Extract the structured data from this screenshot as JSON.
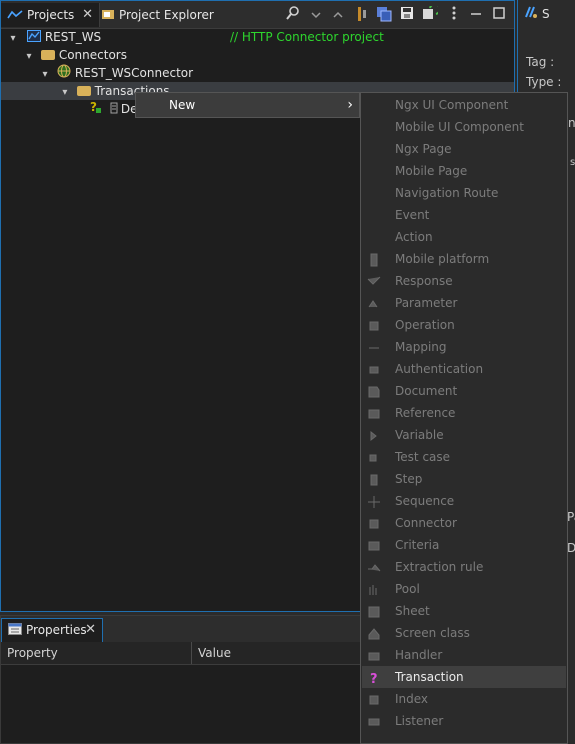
{
  "projects_view": {
    "tab_projects": "Projects",
    "tab_explorer": "Project Explorer",
    "toolbar_icons": [
      "search-icon",
      "dropdown-arrow-icon",
      "collapse-icon",
      "filter-icon",
      "stack-icon",
      "save-icon",
      "refresh-icon",
      "view-menu-icon",
      "minimize-icon",
      "maximize-icon"
    ],
    "tree": {
      "project": "REST_WS",
      "comment": "// HTTP Connector project",
      "connectors": "Connectors",
      "connector": "REST_WSConnector",
      "transactions": "Transactions",
      "transaction_partial": "De"
    }
  },
  "right_view": {
    "tab_label": "S",
    "tag_label": "Tag :",
    "type_label": "Type :",
    "partial_a": "n",
    "partial_b": "s",
    "partial_c": "Pa",
    "partial_d": "Do"
  },
  "properties_view": {
    "tab_label": "Properties",
    "col_property": "Property",
    "col_value": "Value"
  },
  "context_menu": {
    "new_label": "New",
    "submenu_arrow": "›"
  },
  "submenu": {
    "items": [
      {
        "label": "Ngx UI Component",
        "enabled": false
      },
      {
        "label": "Mobile UI Component",
        "enabled": false
      },
      {
        "label": "Ngx Page",
        "enabled": false
      },
      {
        "label": "Mobile Page",
        "enabled": false
      },
      {
        "label": "Navigation Route",
        "enabled": false
      },
      {
        "label": "Event",
        "enabled": false
      },
      {
        "label": "Action",
        "enabled": false
      },
      {
        "label": "Mobile platform",
        "enabled": false
      },
      {
        "label": "Response",
        "enabled": false
      },
      {
        "label": "Parameter",
        "enabled": false
      },
      {
        "label": "Operation",
        "enabled": false
      },
      {
        "label": "Mapping",
        "enabled": false
      },
      {
        "label": "Authentication",
        "enabled": false
      },
      {
        "label": "Document",
        "enabled": false
      },
      {
        "label": "Reference",
        "enabled": false
      },
      {
        "label": "Variable",
        "enabled": false
      },
      {
        "label": "Test case",
        "enabled": false
      },
      {
        "label": "Step",
        "enabled": false
      },
      {
        "label": "Sequence",
        "enabled": false
      },
      {
        "label": "Connector",
        "enabled": false
      },
      {
        "label": "Criteria",
        "enabled": false
      },
      {
        "label": "Extraction rule",
        "enabled": false
      },
      {
        "label": "Pool",
        "enabled": false
      },
      {
        "label": "Sheet",
        "enabled": false
      },
      {
        "label": "Screen class",
        "enabled": false
      },
      {
        "label": "Handler",
        "enabled": false
      },
      {
        "label": "Transaction",
        "enabled": true,
        "selected": true
      },
      {
        "label": "Index",
        "enabled": false
      },
      {
        "label": "Listener",
        "enabled": false
      }
    ]
  },
  "colors": {
    "accent_blue": "#1f6fb0",
    "comment_green": "#2ed52e",
    "folder": "#d8b15a",
    "transaction_icon": "#d84fd8"
  }
}
